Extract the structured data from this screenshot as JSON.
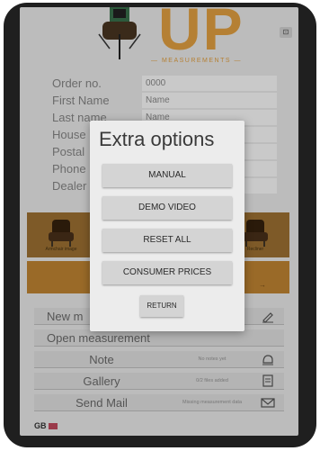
{
  "header": {
    "logo_text": "UP",
    "logo_sub": "— MEASUREMENTS —"
  },
  "form": {
    "rows": [
      {
        "label": "Order no.",
        "value": "0000"
      },
      {
        "label": "First Name",
        "value": "Name"
      },
      {
        "label": "Last name",
        "value": "Name"
      },
      {
        "label": "House",
        "value": ""
      },
      {
        "label": "Postal",
        "value": ""
      },
      {
        "label": "Phone",
        "value": ""
      },
      {
        "label": "Dealer",
        "value": ""
      }
    ]
  },
  "images": {
    "left_label": "Armchair image",
    "right_label": "Recliner"
  },
  "actions": {
    "new_measurement": "New m",
    "open_measurement": "Open measurement",
    "note": {
      "label": "Note",
      "status": "No notes yet"
    },
    "gallery": {
      "label": "Gallery",
      "status": "0/2 files added"
    },
    "send_mail": {
      "label": "Send Mail",
      "status": "Missing measurement data"
    }
  },
  "language": "GB",
  "modal": {
    "title": "Extra options",
    "buttons": [
      "MANUAL",
      "DEMO VIDEO",
      "RESET ALL",
      "CONSUMER PRICES"
    ],
    "return": "RETURN"
  }
}
